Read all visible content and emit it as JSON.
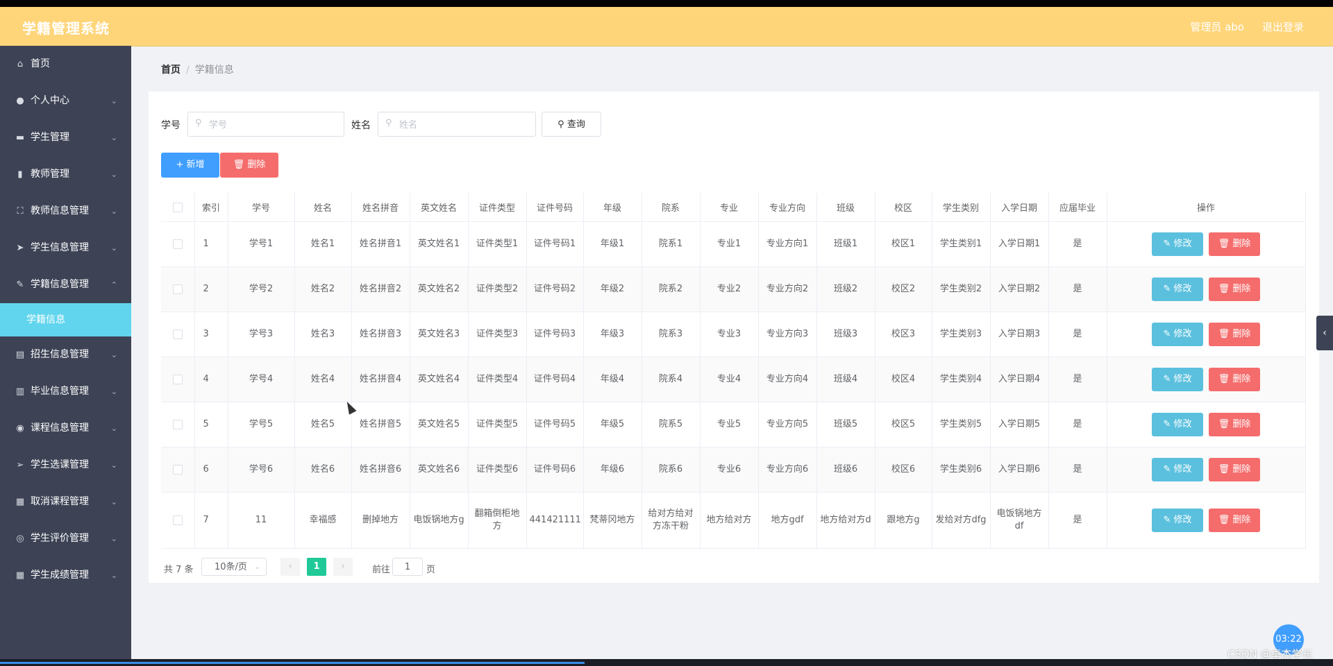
{
  "header": {
    "title": "学籍管理系统",
    "user": "管理员 abo",
    "logout": "退出登录"
  },
  "sidebar": {
    "items": [
      {
        "label": "首页",
        "icon": "⌂",
        "expand": false
      },
      {
        "label": "个人中心",
        "icon": "●",
        "expand": true
      },
      {
        "label": "学生管理",
        "icon": "▬",
        "expand": true
      },
      {
        "label": "教师管理",
        "icon": "▮",
        "expand": true
      },
      {
        "label": "教师信息管理",
        "icon": "⛶",
        "expand": true
      },
      {
        "label": "学生信息管理",
        "icon": "➤",
        "expand": true
      },
      {
        "label": "学籍信息管理",
        "icon": "✎",
        "expand": true
      },
      {
        "label": "招生信息管理",
        "icon": "▤",
        "expand": true
      },
      {
        "label": "毕业信息管理",
        "icon": "▥",
        "expand": true
      },
      {
        "label": "课程信息管理",
        "icon": "◉",
        "expand": true
      },
      {
        "label": "学生选课管理",
        "icon": "➢",
        "expand": true
      },
      {
        "label": "取消课程管理",
        "icon": "▦",
        "expand": true
      },
      {
        "label": "学生评价管理",
        "icon": "◎",
        "expand": true
      },
      {
        "label": "学生成绩管理",
        "icon": "▦",
        "expand": true
      }
    ],
    "submenu_label": "学籍信息"
  },
  "breadcrumb": {
    "home": "首页",
    "separator": "/",
    "current": "学籍信息"
  },
  "search": {
    "no_label": "学号",
    "no_placeholder": "学号",
    "name_label": "姓名",
    "name_placeholder": "姓名",
    "query_button": "查询"
  },
  "toolbar": {
    "add_button": "+ 新增",
    "delete_button": "删除"
  },
  "table": {
    "columns": [
      "索引",
      "学号",
      "姓名",
      "姓名拼音",
      "英文姓名",
      "证件类型",
      "证件号码",
      "年级",
      "院系",
      "专业",
      "专业方向",
      "班级",
      "校区",
      "学生类别",
      "入学日期",
      "应届毕业",
      "操作"
    ],
    "rows": [
      [
        "1",
        "学号1",
        "姓名1",
        "姓名拼音1",
        "英文姓名1",
        "证件类型1",
        "证件号码1",
        "年级1",
        "院系1",
        "专业1",
        "专业方向1",
        "班级1",
        "校区1",
        "学生类别1",
        "入学日期1",
        "是"
      ],
      [
        "2",
        "学号2",
        "姓名2",
        "姓名拼音2",
        "英文姓名2",
        "证件类型2",
        "证件号码2",
        "年级2",
        "院系2",
        "专业2",
        "专业方向2",
        "班级2",
        "校区2",
        "学生类别2",
        "入学日期2",
        "是"
      ],
      [
        "3",
        "学号3",
        "姓名3",
        "姓名拼音3",
        "英文姓名3",
        "证件类型3",
        "证件号码3",
        "年级3",
        "院系3",
        "专业3",
        "专业方向3",
        "班级3",
        "校区3",
        "学生类别3",
        "入学日期3",
        "是"
      ],
      [
        "4",
        "学号4",
        "姓名4",
        "姓名拼音4",
        "英文姓名4",
        "证件类型4",
        "证件号码4",
        "年级4",
        "院系4",
        "专业4",
        "专业方向4",
        "班级4",
        "校区4",
        "学生类别4",
        "入学日期4",
        "是"
      ],
      [
        "5",
        "学号5",
        "姓名5",
        "姓名拼音5",
        "英文姓名5",
        "证件类型5",
        "证件号码5",
        "年级5",
        "院系5",
        "专业5",
        "专业方向5",
        "班级5",
        "校区5",
        "学生类别5",
        "入学日期5",
        "是"
      ],
      [
        "6",
        "学号6",
        "姓名6",
        "姓名拼音6",
        "英文姓名6",
        "证件类型6",
        "证件号码6",
        "年级6",
        "院系6",
        "专业6",
        "专业方向6",
        "班级6",
        "校区6",
        "学生类别6",
        "入学日期6",
        "是"
      ],
      [
        "7",
        "11",
        "幸福感",
        "删掉地方",
        "电饭锅地方g",
        "翻箱倒柜地方",
        "441421111",
        "梵蒂冈地方",
        "给对方给对方冻干粉",
        "地方给对方",
        "地方gdf",
        "地方给对方d",
        "跟地方g",
        "发给对方dfg",
        "电饭锅地方df",
        "是"
      ]
    ],
    "edit_button": "修改",
    "delete_button": "删除"
  },
  "pagination": {
    "total": "共 7 条",
    "page_size": "10条/页",
    "current_page": "1",
    "goto_label": "前往",
    "goto_value": "1",
    "page_word": "页"
  },
  "overlay": {
    "clock": "03:22",
    "watermark": "CSDN @卓杰学长"
  },
  "colors": {
    "header": "#ffd57a",
    "sidebar": "#3d4355",
    "submenu_active": "#62d5ee",
    "primary": "#409eff",
    "danger": "#f56c6c",
    "edit": "#5bc0de",
    "page_active": "#20c997"
  }
}
